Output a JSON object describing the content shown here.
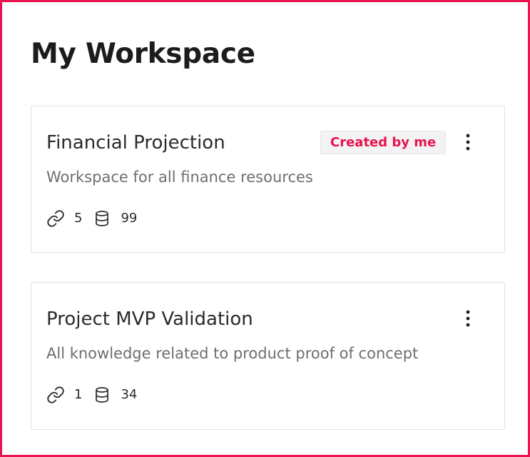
{
  "page": {
    "title": "My Workspace",
    "accent_color": "#e8134f"
  },
  "workspaces": [
    {
      "title": "Financial Projection",
      "badge": "Created by me",
      "description": "Workspace for all finance resources",
      "links_count": "5",
      "datasets_count": "99",
      "icons": [
        "link-icon",
        "database-icon",
        "more-vertical-icon"
      ]
    },
    {
      "title": "Project MVP Validation",
      "description": "All knowledge related to product proof of concept",
      "links_count": "1",
      "datasets_count": "34",
      "icons": [
        "link-icon",
        "database-icon",
        "more-vertical-icon"
      ]
    }
  ]
}
